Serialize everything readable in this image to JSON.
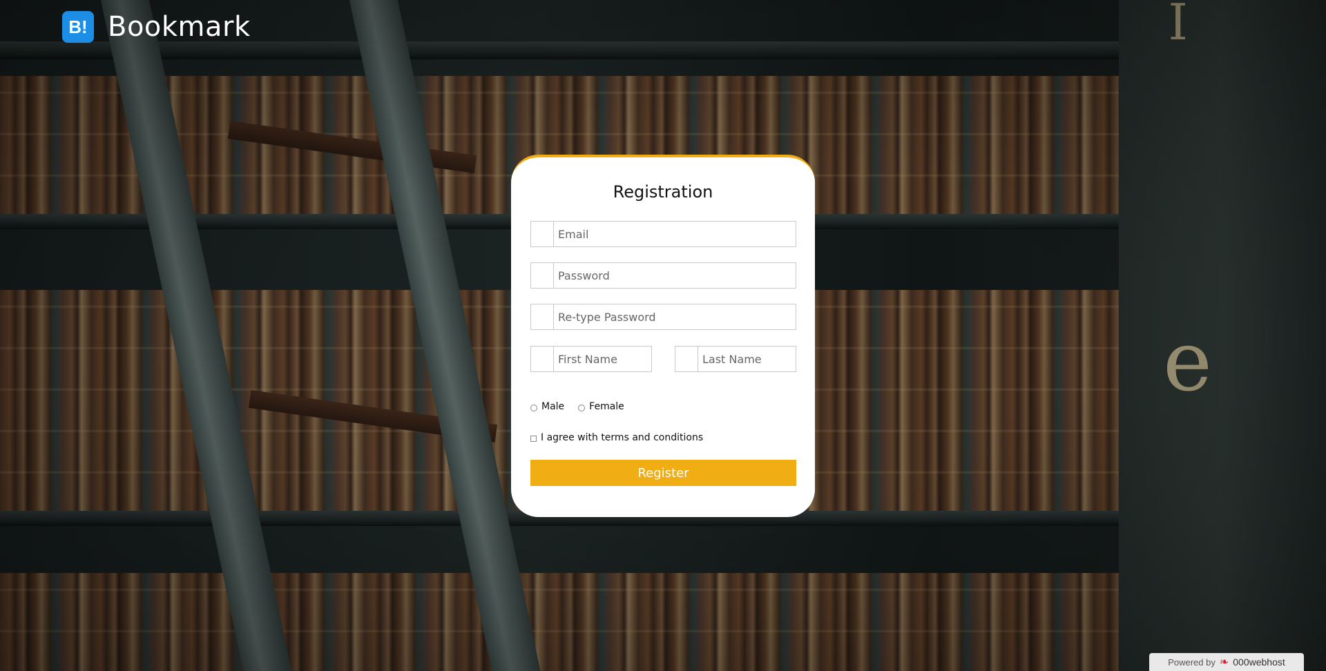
{
  "brand": {
    "logo_text": "B!",
    "name": "Bookmark"
  },
  "form": {
    "title": "Registration",
    "email_placeholder": "Email",
    "password_placeholder": "Password",
    "retype_password_placeholder": "Re-type Password",
    "first_name_placeholder": "First Name",
    "last_name_placeholder": "Last Name",
    "gender_options": [
      "Male",
      "Female"
    ],
    "terms_label": "I agree with terms and conditions",
    "register_label": "Register"
  },
  "footer": {
    "powered_label": "Powered by",
    "host_name": "000webhost",
    "host_icon": "000webhost-icon"
  },
  "background": {
    "right_glyph_top": "I",
    "right_glyph_mid": "e"
  },
  "colors": {
    "accent": "#f0ad14",
    "brand_blue": "#1d8ee6",
    "card": "#ffffff"
  }
}
